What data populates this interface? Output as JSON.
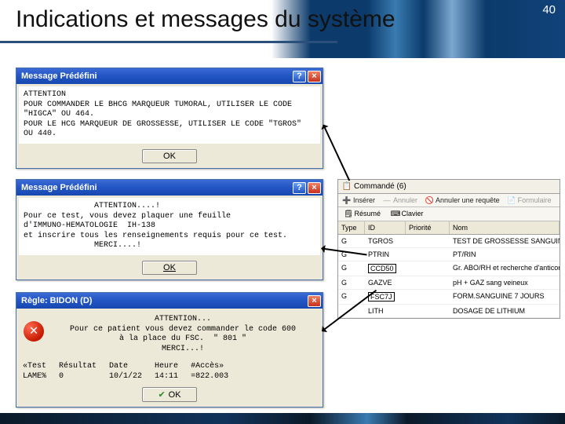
{
  "page": {
    "title": "Indications et messages du système",
    "number": "40"
  },
  "dialog1": {
    "title": "Message Prédéfini",
    "body": "ATTENTION\nPOUR COMMANDER LE BHCG MARQUEUR TUMORAL, UTILISER LE CODE\n\"HIGCA\" OU 464.\nPOUR LE HCG MARQUEUR DE GROSSESSE, UTILISER LE CODE \"TGROS\"\nOU 440.",
    "ok": "OK"
  },
  "dialog2": {
    "title": "Message Prédéfini",
    "body": "               ATTENTION....!\nPour ce test, vous devez plaquer une feuille\nd'IMMUNO-HEMATOLOGIE  IH-138\net inscrire tous les renseignements requis pour ce test.\n               MERCI....!",
    "ok": "OK"
  },
  "dialog3": {
    "title": "Règle: BIDON (D)",
    "bodyCenter": "ATTENTION...\nPour ce patient vous devez commander le code 600\nà la place du FSC.  \" 801 \"\nMERCI...!",
    "tableHeaders": {
      "c1": "«Test",
      "c2": "Résultat",
      "c3": "Date",
      "c4": "Heure",
      "c5": "#Accès»"
    },
    "tableRow": {
      "c1": "LAME%",
      "c2": "0",
      "c3": "10/1/22",
      "c4": "14:11",
      "c5": "=822.003"
    },
    "ok": "OK"
  },
  "panel": {
    "tab": {
      "label": "Commandé (6)"
    },
    "toolbar": {
      "insert": "Insérer",
      "cancel": "Annuler",
      "cancelReq": "Annuler une requête",
      "form": "Formulaire"
    },
    "subToolbar": {
      "summary": "Résumé",
      "keyboard": "Clavier"
    },
    "headers": {
      "type": "Type",
      "id": "ID",
      "priority": "Priorité",
      "name": "Nom"
    },
    "rows": [
      {
        "type": "G",
        "id": "TGROS",
        "name": "TEST DE GROSSESSE SANGUIN",
        "boxed": false
      },
      {
        "type": "G",
        "id": "PTRIN",
        "name": "PT/RIN",
        "boxed": false
      },
      {
        "type": "G",
        "id": "CCD50",
        "name": "Gr. ABO/RH et recherche d'anticorps irrégu",
        "boxed": true
      },
      {
        "type": "G",
        "id": "GAZVE",
        "name": "pH + GAZ sang veineux",
        "boxed": false
      },
      {
        "type": "G",
        "id": "FSC7J",
        "name": "FORM.SANGUINE 7 JOURS",
        "boxed": true
      },
      {
        "type": "",
        "id": "LITH",
        "name": "DOSAGE DE LITHIUM",
        "boxed": false
      }
    ]
  }
}
